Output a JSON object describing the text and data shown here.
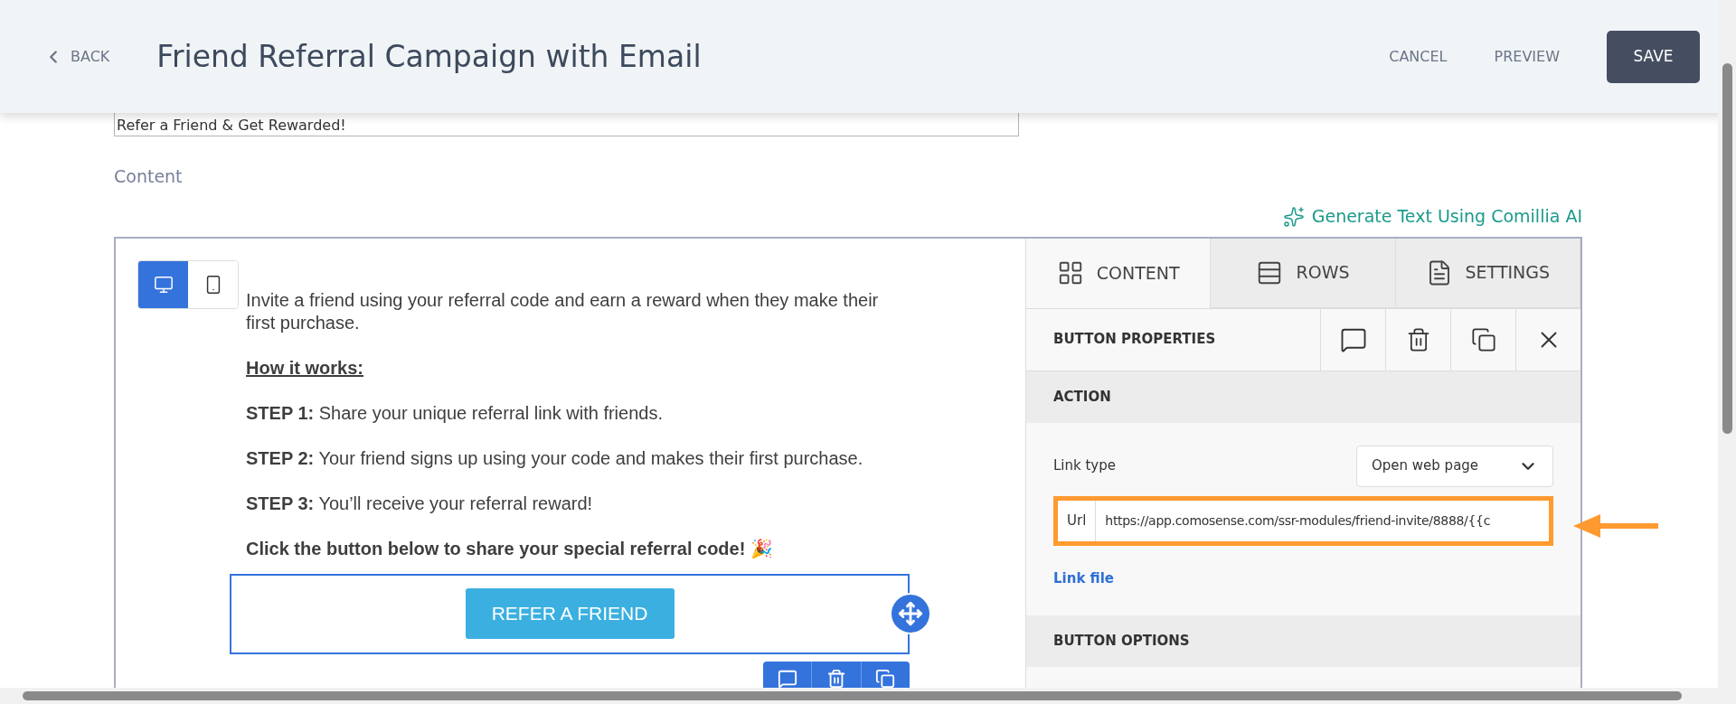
{
  "header": {
    "back": "BACK",
    "title": "Friend Referral Campaign with Email",
    "actions": [
      "CANCEL",
      "PREVIEW"
    ],
    "save": "SAVE"
  },
  "subject": {
    "value": "Refer a Friend & Get Rewarded!"
  },
  "content_label": "Content",
  "generate_link": "Generate Text Using Comillia AI",
  "editor": {
    "devices": [
      {
        "kind": "desktop",
        "selected": true
      },
      {
        "kind": "mobile",
        "selected": false
      }
    ],
    "paragraphs": [
      {
        "kind": "text",
        "text": "Invite a friend using your referral code and earn a reward when they make their first purchase."
      },
      {
        "kind": "heading",
        "text": "How it works:"
      },
      {
        "kind": "text",
        "text": "**STEP 1:** Share your unique referral link with friends."
      },
      {
        "kind": "text",
        "text": "**STEP 2:** Your friend signs up using your code and makes their first purchase."
      },
      {
        "kind": "text",
        "text": "**STEP 3:** You’ll receive your referral reward!"
      },
      {
        "kind": "bold",
        "text": "Click the button below to share your special referral code! 🎉"
      }
    ],
    "cta_button": "REFER A FRIEND"
  },
  "panel": {
    "tabs": [
      {
        "kind": "grid",
        "label": "CONTENT",
        "selected": true
      },
      {
        "kind": "rows",
        "label": "ROWS",
        "selected": false
      },
      {
        "kind": "settings",
        "label": "SETTINGS",
        "selected": false
      }
    ],
    "title": "BUTTON PROPERTIES",
    "sections": [
      {
        "title": "ACTION"
      },
      {
        "title": "BUTTON OPTIONS"
      }
    ],
    "link_type_label": "Link type",
    "link_type_value": "Open web page",
    "url_label": "Url",
    "url_value": "https://app.comosense.com/ssr-modules/friend-invite/8888/{{c",
    "link_file": "Link file"
  }
}
